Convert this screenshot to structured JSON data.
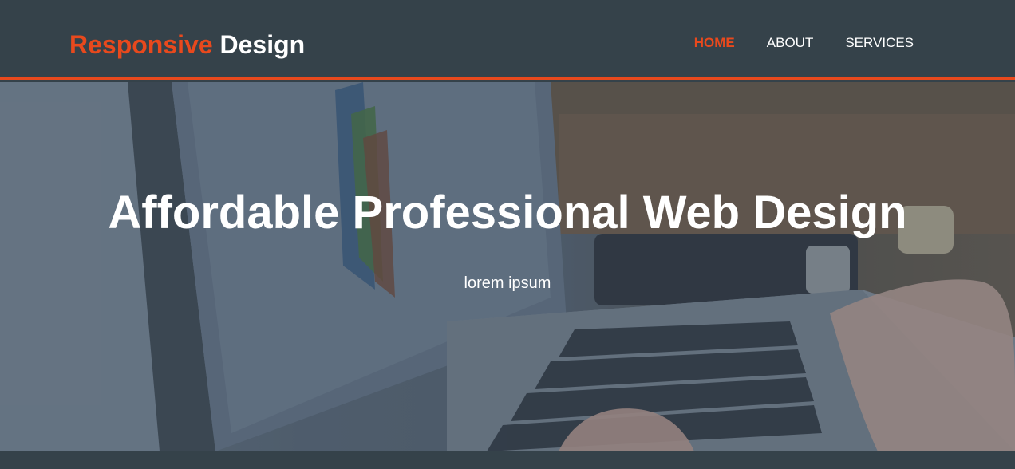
{
  "brand": {
    "highlight": "Responsive",
    "rest": "Design",
    "accent_color": "#e8491d"
  },
  "nav": {
    "items": [
      {
        "label": "HOME",
        "current": true
      },
      {
        "label": "ABOUT",
        "current": false
      },
      {
        "label": "SERVICES",
        "current": false
      }
    ]
  },
  "showcase": {
    "title": "Affordable Professional Web Design",
    "subtitle": "lorem ipsum",
    "background_image": "laptop-keyboard-photo"
  },
  "colors": {
    "header_bg": "#35424a",
    "accent": "#e8491d",
    "text": "#ffffff"
  }
}
